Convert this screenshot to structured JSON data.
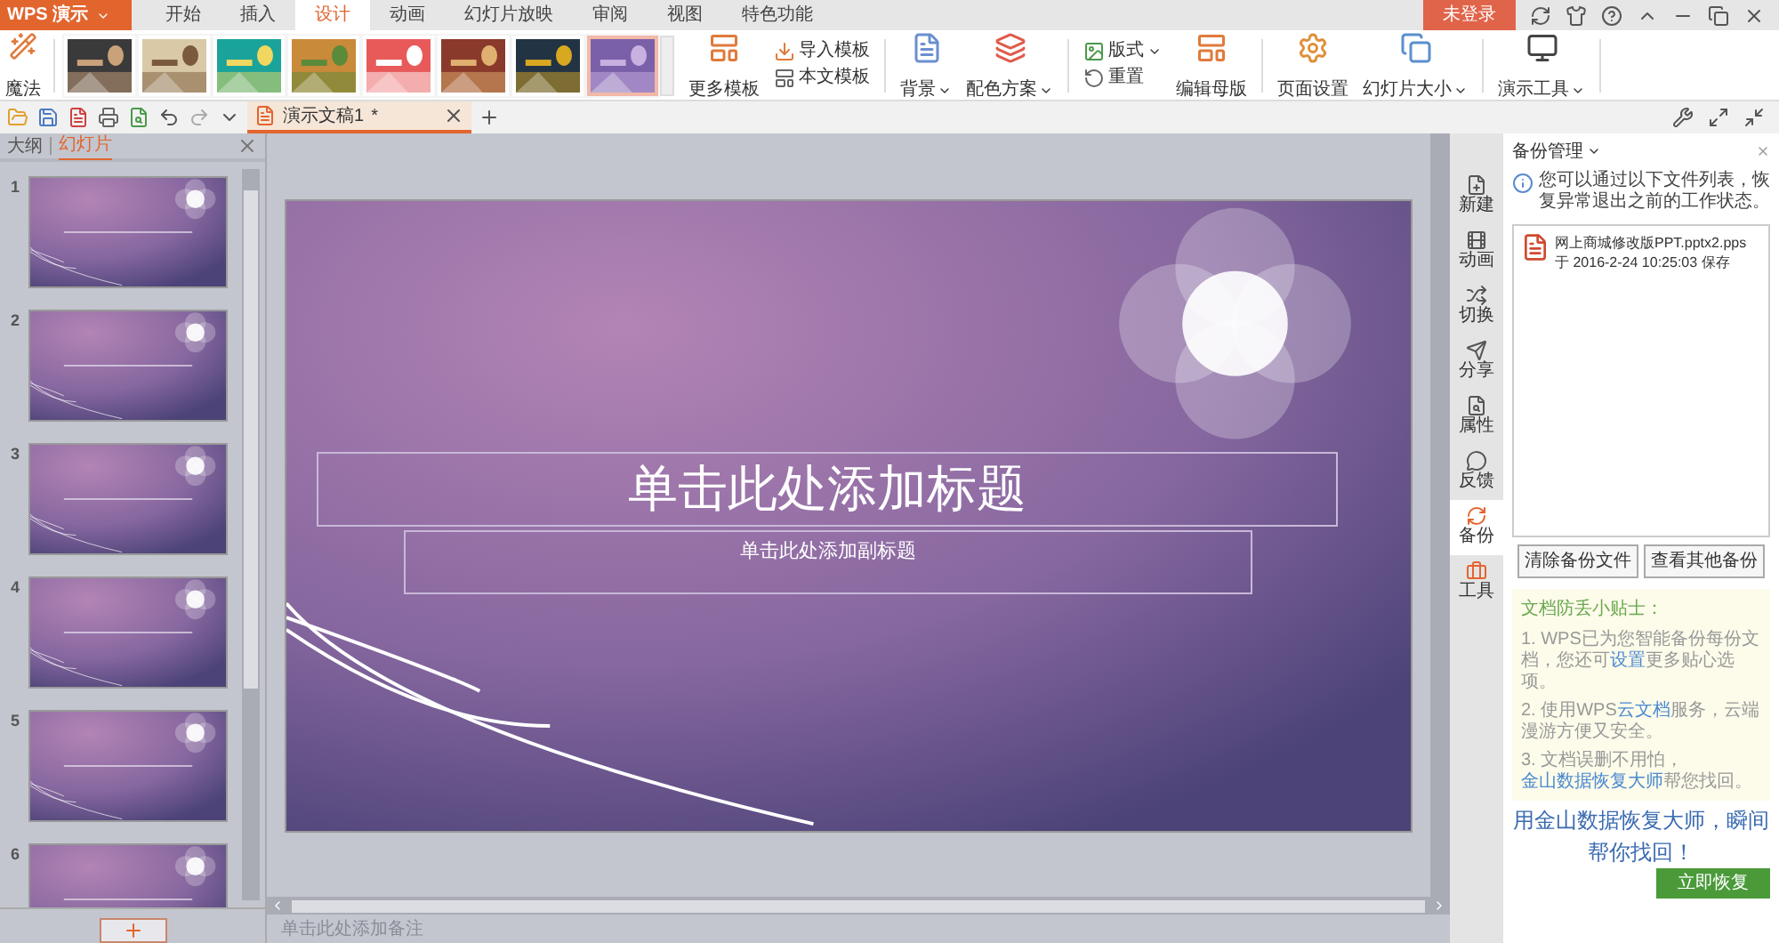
{
  "app_button": {
    "label": "WPS 演示"
  },
  "menu_tabs": [
    {
      "label": "开始",
      "selected": false
    },
    {
      "label": "插入",
      "selected": false
    },
    {
      "label": "设计",
      "selected": true
    },
    {
      "label": "动画",
      "selected": false
    },
    {
      "label": "幻灯片放映",
      "selected": false
    },
    {
      "label": "审阅",
      "selected": false
    },
    {
      "label": "视图",
      "selected": false
    },
    {
      "label": "特色功能",
      "selected": false
    }
  ],
  "login_button": {
    "label": "未登录"
  },
  "ribbon": {
    "magic": {
      "label": "魔法"
    },
    "templates": [
      {
        "kind": "picture",
        "selected": false
      },
      {
        "kind": "picture",
        "selected": false
      },
      {
        "kind": "picture",
        "selected": false
      },
      {
        "kind": "picture",
        "selected": false
      },
      {
        "kind": "picture",
        "selected": false
      },
      {
        "kind": "picture",
        "selected": false
      },
      {
        "kind": "picture",
        "selected": false
      },
      {
        "kind": "picture",
        "selected": true
      }
    ],
    "more_templates": {
      "label": "更多模板"
    },
    "import_template": {
      "label": "导入模板"
    },
    "doc_template": {
      "label": "本文模板"
    },
    "large": [
      {
        "kind": "background",
        "label": "背景",
        "dropdown": true
      },
      {
        "kind": "colors",
        "label": "配色方案",
        "dropdown": true
      }
    ],
    "layout": {
      "label": "版式",
      "dropdown": true
    },
    "reset": {
      "label": "重置"
    },
    "tools": [
      {
        "kind": "master",
        "label": "编辑母版",
        "dropdown": false
      },
      {
        "kind": "page",
        "label": "页面设置",
        "dropdown": false
      },
      {
        "kind": "size",
        "label": "幻灯片大小",
        "dropdown": true
      },
      {
        "kind": "present",
        "label": "演示工具",
        "dropdown": true
      }
    ]
  },
  "doc_tab": {
    "title": "演示文稿1",
    "modified": "*"
  },
  "left_panel": {
    "tabs": [
      {
        "label": "大纲",
        "selected": false
      },
      {
        "label": "幻灯片",
        "selected": true
      }
    ],
    "slides": [
      {
        "number": "1"
      },
      {
        "number": "2"
      },
      {
        "number": "3"
      },
      {
        "number": "4"
      },
      {
        "number": "5"
      },
      {
        "number": "6"
      }
    ]
  },
  "slide": {
    "title_placeholder": "单击此处添加标题",
    "subtitle_placeholder": "单击此处添加副标题"
  },
  "notes": {
    "placeholder": "单击此处添加备注"
  },
  "side_tools": [
    {
      "kind": "new",
      "label": "新建",
      "selected": false
    },
    {
      "kind": "animation",
      "label": "动画",
      "selected": false
    },
    {
      "kind": "transition",
      "label": "切换",
      "selected": false
    },
    {
      "kind": "share",
      "label": "分享",
      "selected": false
    },
    {
      "kind": "properties",
      "label": "属性",
      "selected": false
    },
    {
      "kind": "feedback",
      "label": "反馈",
      "selected": false
    },
    {
      "kind": "backup",
      "label": "备份",
      "selected": true
    },
    {
      "kind": "tools",
      "label": "工具",
      "selected": false
    }
  ],
  "backup_panel": {
    "title": "备份管理",
    "info": "您可以通过以下文件列表，恢复异常退出之前的工作状态。",
    "files": [
      {
        "name": "网上商城修改版PPT.pptx2.pps",
        "saved": "于 2016-2-24 10:25:03 保存"
      }
    ],
    "buttons": [
      "清除备份文件",
      "查看其他备份"
    ],
    "tips_title": "文档防丢小贴士：",
    "tips": [
      {
        "before": "1. WPS已为您智能备份每份文档，您还可",
        "link": "设置",
        "after": "更多贴心选项。"
      },
      {
        "before": "2. 使用WPS",
        "link": "云文档",
        "after": "服务，云端漫游方便又安全。"
      },
      {
        "before": "3. 文档误删不用怕，",
        "link": "金山数据恢复大师",
        "after": "帮您找回。"
      }
    ],
    "promo": {
      "lines": [
        "用金山数据恢复大师，瞬间",
        "帮你找回！"
      ],
      "button": "立即恢复"
    }
  }
}
